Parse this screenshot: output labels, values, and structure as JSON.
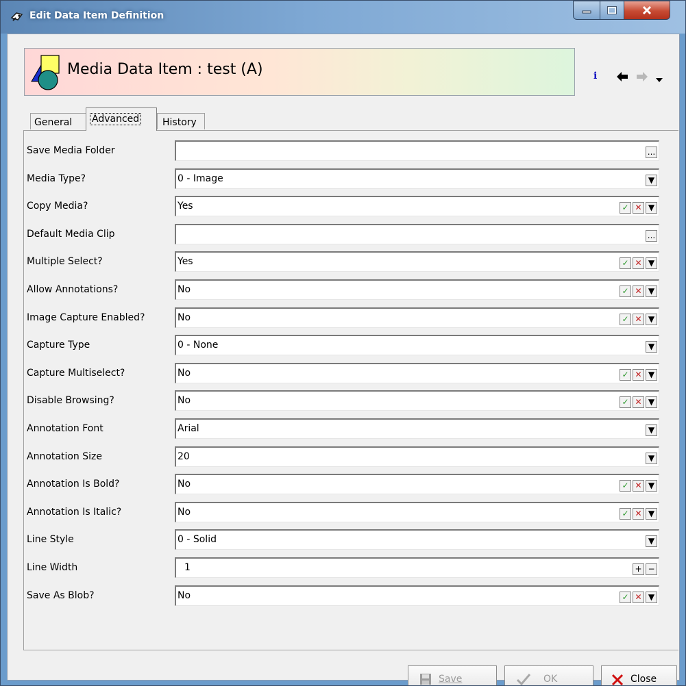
{
  "window": {
    "title": "Edit Data Item Definition",
    "min_label": "—",
    "max_label": "□",
    "close_label": "X"
  },
  "header": {
    "title": "Media Data Item : test (A)",
    "info_label": "i",
    "back_label": "←",
    "forward_label": "→",
    "menu_label": "▼"
  },
  "tabs": [
    {
      "label": "General",
      "active": false
    },
    {
      "label": "Advanced",
      "active": true
    },
    {
      "label": "History",
      "active": false
    }
  ],
  "rows": [
    {
      "label": "Save Media Folder",
      "value": "",
      "buttons": [
        "..."
      ]
    },
    {
      "label": "Media Type?",
      "value": "0 - Image",
      "buttons": [
        "▼"
      ]
    },
    {
      "label": "Copy Media?",
      "value": "Yes",
      "buttons": [
        "✓",
        "✕",
        "▼"
      ]
    },
    {
      "label": "Default Media Clip",
      "value": "",
      "buttons": [
        "..."
      ]
    },
    {
      "label": "Multiple Select?",
      "value": "Yes",
      "buttons": [
        "✓",
        "✕",
        "▼"
      ]
    },
    {
      "label": "Allow Annotations?",
      "value": "No",
      "buttons": [
        "✓",
        "✕",
        "▼"
      ]
    },
    {
      "label": "Image Capture Enabled?",
      "value": "No",
      "buttons": [
        "✓",
        "✕",
        "▼"
      ]
    },
    {
      "label": "Capture Type",
      "value": "0 - None",
      "buttons": [
        "▼"
      ]
    },
    {
      "label": "Capture Multiselect?",
      "value": "No",
      "buttons": [
        "✓",
        "✕",
        "▼"
      ]
    },
    {
      "label": "Disable Browsing?",
      "value": "No",
      "buttons": [
        "✓",
        "✕",
        "▼"
      ]
    },
    {
      "label": "Annotation Font",
      "value": "Arial",
      "buttons": [
        "▼"
      ]
    },
    {
      "label": "Annotation Size",
      "value": "20",
      "buttons": [
        "▼"
      ]
    },
    {
      "label": "Annotation Is Bold?",
      "value": "No",
      "buttons": [
        "✓",
        "✕",
        "▼"
      ]
    },
    {
      "label": "Annotation Is Italic?",
      "value": "No",
      "buttons": [
        "✓",
        "✕",
        "▼"
      ]
    },
    {
      "label": "Line Style",
      "value": "0 - Solid",
      "buttons": [
        "▼"
      ]
    },
    {
      "label": "Line Width",
      "value": "1",
      "buttons": [
        "+",
        "−"
      ]
    },
    {
      "label": "Save As Blob?",
      "value": "No",
      "buttons": [
        "✓",
        "✕",
        "▼"
      ]
    }
  ],
  "footer": {
    "save_label": "Save",
    "ok_label": "OK",
    "close_label": "Close"
  },
  "colors": {
    "title_bar": "#6e98c6",
    "header_gradient_start": "#ffd7d7",
    "header_gradient_end": "#ddf5dd",
    "check_green": "#2f9a2f",
    "cross_red": "#c02020"
  }
}
